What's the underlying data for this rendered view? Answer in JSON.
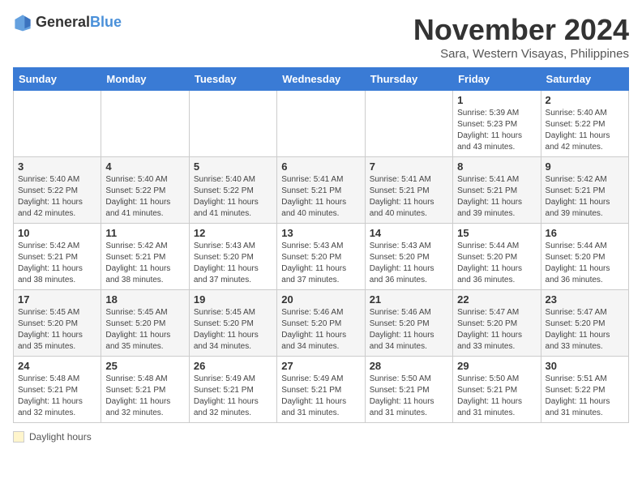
{
  "header": {
    "logo_general": "General",
    "logo_blue": "Blue",
    "month_title": "November 2024",
    "location": "Sara, Western Visayas, Philippines"
  },
  "days_of_week": [
    "Sunday",
    "Monday",
    "Tuesday",
    "Wednesday",
    "Thursday",
    "Friday",
    "Saturday"
  ],
  "weeks": [
    [
      {
        "day": "",
        "info": ""
      },
      {
        "day": "",
        "info": ""
      },
      {
        "day": "",
        "info": ""
      },
      {
        "day": "",
        "info": ""
      },
      {
        "day": "",
        "info": ""
      },
      {
        "day": "1",
        "info": "Sunrise: 5:39 AM\nSunset: 5:23 PM\nDaylight: 11 hours and 43 minutes."
      },
      {
        "day": "2",
        "info": "Sunrise: 5:40 AM\nSunset: 5:22 PM\nDaylight: 11 hours and 42 minutes."
      }
    ],
    [
      {
        "day": "3",
        "info": "Sunrise: 5:40 AM\nSunset: 5:22 PM\nDaylight: 11 hours and 42 minutes."
      },
      {
        "day": "4",
        "info": "Sunrise: 5:40 AM\nSunset: 5:22 PM\nDaylight: 11 hours and 41 minutes."
      },
      {
        "day": "5",
        "info": "Sunrise: 5:40 AM\nSunset: 5:22 PM\nDaylight: 11 hours and 41 minutes."
      },
      {
        "day": "6",
        "info": "Sunrise: 5:41 AM\nSunset: 5:21 PM\nDaylight: 11 hours and 40 minutes."
      },
      {
        "day": "7",
        "info": "Sunrise: 5:41 AM\nSunset: 5:21 PM\nDaylight: 11 hours and 40 minutes."
      },
      {
        "day": "8",
        "info": "Sunrise: 5:41 AM\nSunset: 5:21 PM\nDaylight: 11 hours and 39 minutes."
      },
      {
        "day": "9",
        "info": "Sunrise: 5:42 AM\nSunset: 5:21 PM\nDaylight: 11 hours and 39 minutes."
      }
    ],
    [
      {
        "day": "10",
        "info": "Sunrise: 5:42 AM\nSunset: 5:21 PM\nDaylight: 11 hours and 38 minutes."
      },
      {
        "day": "11",
        "info": "Sunrise: 5:42 AM\nSunset: 5:21 PM\nDaylight: 11 hours and 38 minutes."
      },
      {
        "day": "12",
        "info": "Sunrise: 5:43 AM\nSunset: 5:20 PM\nDaylight: 11 hours and 37 minutes."
      },
      {
        "day": "13",
        "info": "Sunrise: 5:43 AM\nSunset: 5:20 PM\nDaylight: 11 hours and 37 minutes."
      },
      {
        "day": "14",
        "info": "Sunrise: 5:43 AM\nSunset: 5:20 PM\nDaylight: 11 hours and 36 minutes."
      },
      {
        "day": "15",
        "info": "Sunrise: 5:44 AM\nSunset: 5:20 PM\nDaylight: 11 hours and 36 minutes."
      },
      {
        "day": "16",
        "info": "Sunrise: 5:44 AM\nSunset: 5:20 PM\nDaylight: 11 hours and 36 minutes."
      }
    ],
    [
      {
        "day": "17",
        "info": "Sunrise: 5:45 AM\nSunset: 5:20 PM\nDaylight: 11 hours and 35 minutes."
      },
      {
        "day": "18",
        "info": "Sunrise: 5:45 AM\nSunset: 5:20 PM\nDaylight: 11 hours and 35 minutes."
      },
      {
        "day": "19",
        "info": "Sunrise: 5:45 AM\nSunset: 5:20 PM\nDaylight: 11 hours and 34 minutes."
      },
      {
        "day": "20",
        "info": "Sunrise: 5:46 AM\nSunset: 5:20 PM\nDaylight: 11 hours and 34 minutes."
      },
      {
        "day": "21",
        "info": "Sunrise: 5:46 AM\nSunset: 5:20 PM\nDaylight: 11 hours and 34 minutes."
      },
      {
        "day": "22",
        "info": "Sunrise: 5:47 AM\nSunset: 5:20 PM\nDaylight: 11 hours and 33 minutes."
      },
      {
        "day": "23",
        "info": "Sunrise: 5:47 AM\nSunset: 5:20 PM\nDaylight: 11 hours and 33 minutes."
      }
    ],
    [
      {
        "day": "24",
        "info": "Sunrise: 5:48 AM\nSunset: 5:21 PM\nDaylight: 11 hours and 32 minutes."
      },
      {
        "day": "25",
        "info": "Sunrise: 5:48 AM\nSunset: 5:21 PM\nDaylight: 11 hours and 32 minutes."
      },
      {
        "day": "26",
        "info": "Sunrise: 5:49 AM\nSunset: 5:21 PM\nDaylight: 11 hours and 32 minutes."
      },
      {
        "day": "27",
        "info": "Sunrise: 5:49 AM\nSunset: 5:21 PM\nDaylight: 11 hours and 31 minutes."
      },
      {
        "day": "28",
        "info": "Sunrise: 5:50 AM\nSunset: 5:21 PM\nDaylight: 11 hours and 31 minutes."
      },
      {
        "day": "29",
        "info": "Sunrise: 5:50 AM\nSunset: 5:21 PM\nDaylight: 11 hours and 31 minutes."
      },
      {
        "day": "30",
        "info": "Sunrise: 5:51 AM\nSunset: 5:22 PM\nDaylight: 11 hours and 31 minutes."
      }
    ]
  ],
  "legend": {
    "daylight_label": "Daylight hours"
  }
}
